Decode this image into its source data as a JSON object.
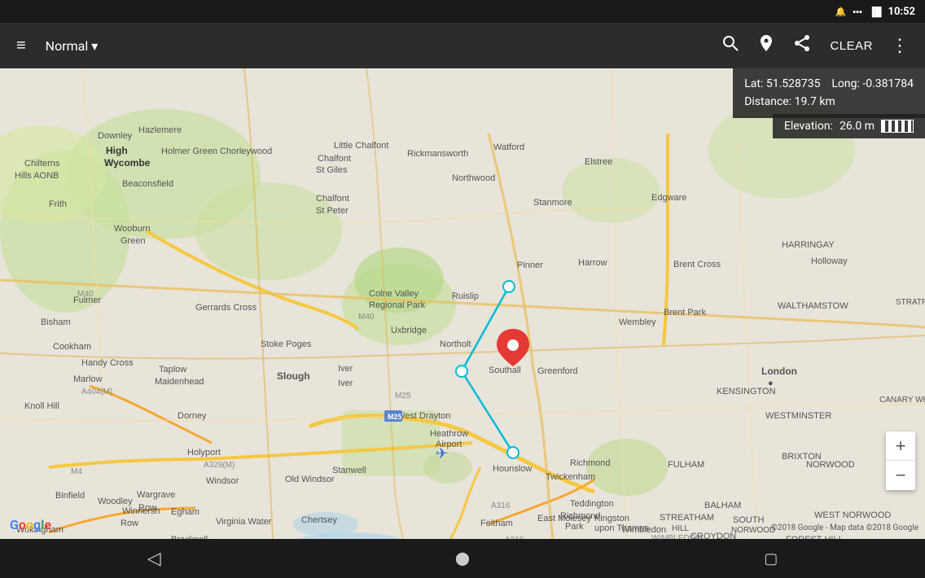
{
  "statusBar": {
    "time": "10:52",
    "batteryIcon": "🔋",
    "signalIcon": "📶"
  },
  "toolbar": {
    "menuIcon": "≡",
    "mapType": "Normal",
    "arrowIcon": "▾",
    "searchIcon": "🔍",
    "waypointIcon": "◈",
    "shareIcon": "⬆",
    "clearLabel": "CLEAR",
    "moreIcon": "⋮"
  },
  "infoOverlay": {
    "lat_label": "Lat:",
    "lat_value": "51.528735",
    "long_label": "Long:",
    "long_value": "-0.381784",
    "distance_label": "Distance:",
    "distance_value": "19.7 km"
  },
  "elevationOverlay": {
    "label": "Elevation:",
    "value": "26.0 m"
  },
  "zoomControls": {
    "zoomInLabel": "+",
    "zoomOutLabel": "−"
  },
  "googleLogo": {
    "text": "Google"
  },
  "mapCopyright": "©2018 Google - Map data ©2018 Google",
  "navBar": {
    "backIcon": "◁",
    "homeIcon": "⬤",
    "squareIcon": "▢"
  }
}
